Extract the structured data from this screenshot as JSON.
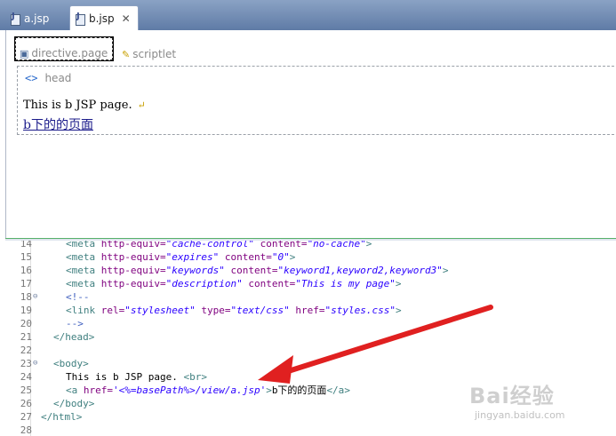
{
  "tabs": [
    {
      "label": "a.jsp"
    },
    {
      "label": "b.jsp",
      "close": "✕"
    }
  ],
  "design": {
    "directive_label": "directive.page",
    "scriptlet_label": "scriptlet",
    "head_label": "head",
    "head_icon": "<>",
    "body_text": "This is b JSP page.",
    "link_text": "b下的的页面"
  },
  "code_lines": [
    {
      "n": "14",
      "text": "<meta http-equiv=\"cache-control\" content=\"no-cache\">"
    },
    {
      "n": "15",
      "text": "<meta http-equiv=\"expires\" content=\"0\">"
    },
    {
      "n": "16",
      "text": "<meta http-equiv=\"keywords\" content=\"keyword1,keyword2,keyword3\">"
    },
    {
      "n": "17",
      "text": "<meta http-equiv=\"description\" content=\"This is my page\">"
    },
    {
      "n": "18",
      "text": "<!--"
    },
    {
      "n": "19",
      "text": "<link rel=\"stylesheet\" type=\"text/css\" href=\"styles.css\">"
    },
    {
      "n": "20",
      "text": "-->"
    },
    {
      "n": "21",
      "text": "</head>"
    },
    {
      "n": "22",
      "text": ""
    },
    {
      "n": "23",
      "text": "<body>"
    },
    {
      "n": "24",
      "text": "This is b JSP page. <br>"
    },
    {
      "n": "25",
      "text": "<a href='<%=basePath%>/view/a.jsp'>b下的的页面</a>"
    },
    {
      "n": "26",
      "text": "</body>"
    },
    {
      "n": "27",
      "text": "</html>"
    },
    {
      "n": "28",
      "text": ""
    }
  ],
  "watermark": {
    "brand": "Bai经验",
    "url": "jingyan.baidu.com"
  },
  "colors": {
    "tab_bar": "#6f89b2",
    "arrow": "#e02020",
    "separator": "#56b06a"
  }
}
